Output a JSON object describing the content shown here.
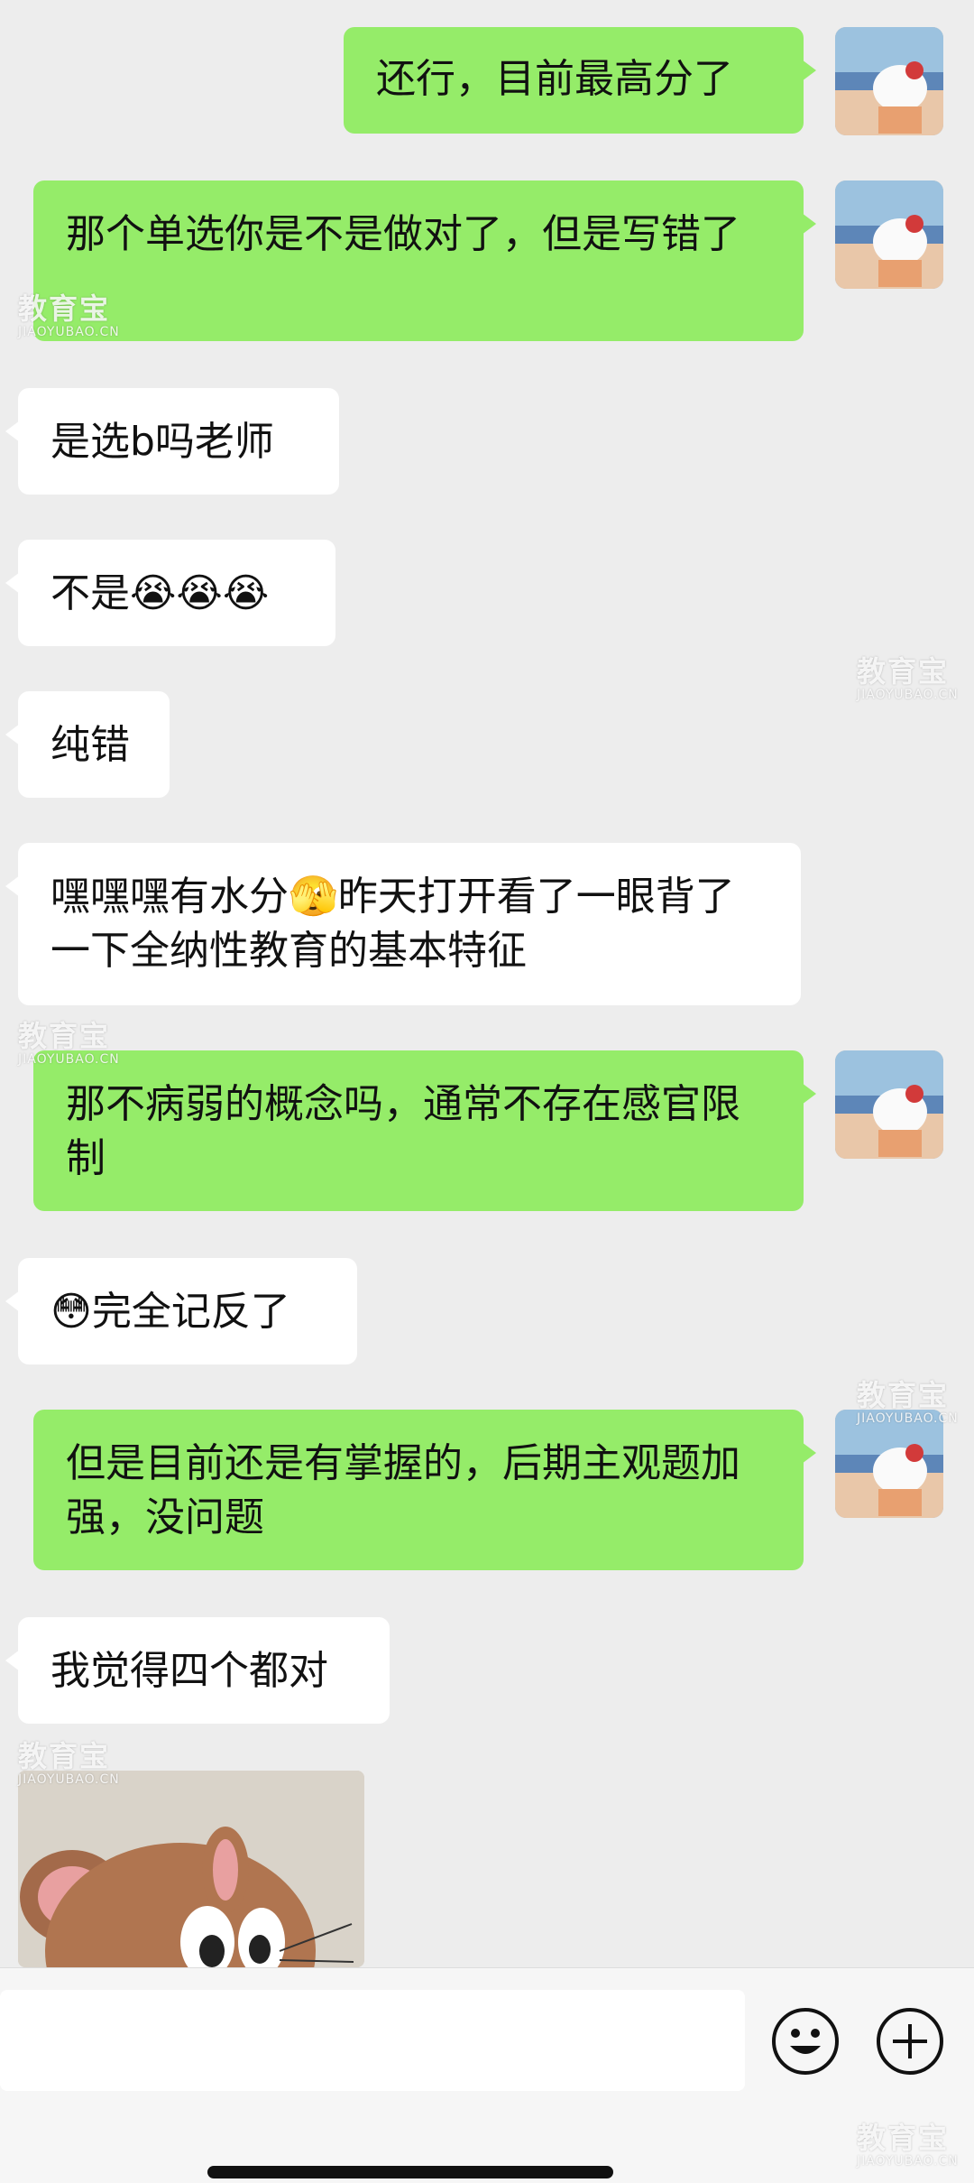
{
  "messages": [
    {
      "side": "me",
      "text": "还行，目前最高分了"
    },
    {
      "side": "me",
      "text": "那个单选你是不是做对了，但是写错了"
    },
    {
      "side": "them",
      "text": "是选b吗老师"
    },
    {
      "side": "them",
      "text": "不是😭😭😭"
    },
    {
      "side": "them",
      "text": "纯错"
    },
    {
      "side": "them",
      "text": "嘿嘿嘿有水分🫣昨天打开看了一眼背了一下全纳性教育的基本特征"
    },
    {
      "side": "me",
      "text": "那不病弱的概念吗，通常不存在感官限制"
    },
    {
      "side": "them",
      "text": "😳完全记反了"
    },
    {
      "side": "me",
      "text": "但是目前还是有掌握的，后期主观题加强，没问题"
    },
    {
      "side": "them",
      "text": "我觉得四个都对"
    }
  ],
  "watermark": {
    "cn": "教育宝",
    "en": "JIAOYUBAO.CN"
  },
  "image_message": {
    "description_icon": "jerry-mouse-sticker"
  },
  "input": {
    "placeholder": ""
  },
  "icons": {
    "emoji": "emoji-icon",
    "plus": "plus-icon"
  },
  "colors": {
    "me_bubble": "#95ec69",
    "them_bubble": "#ffffff",
    "background": "#ededed"
  }
}
